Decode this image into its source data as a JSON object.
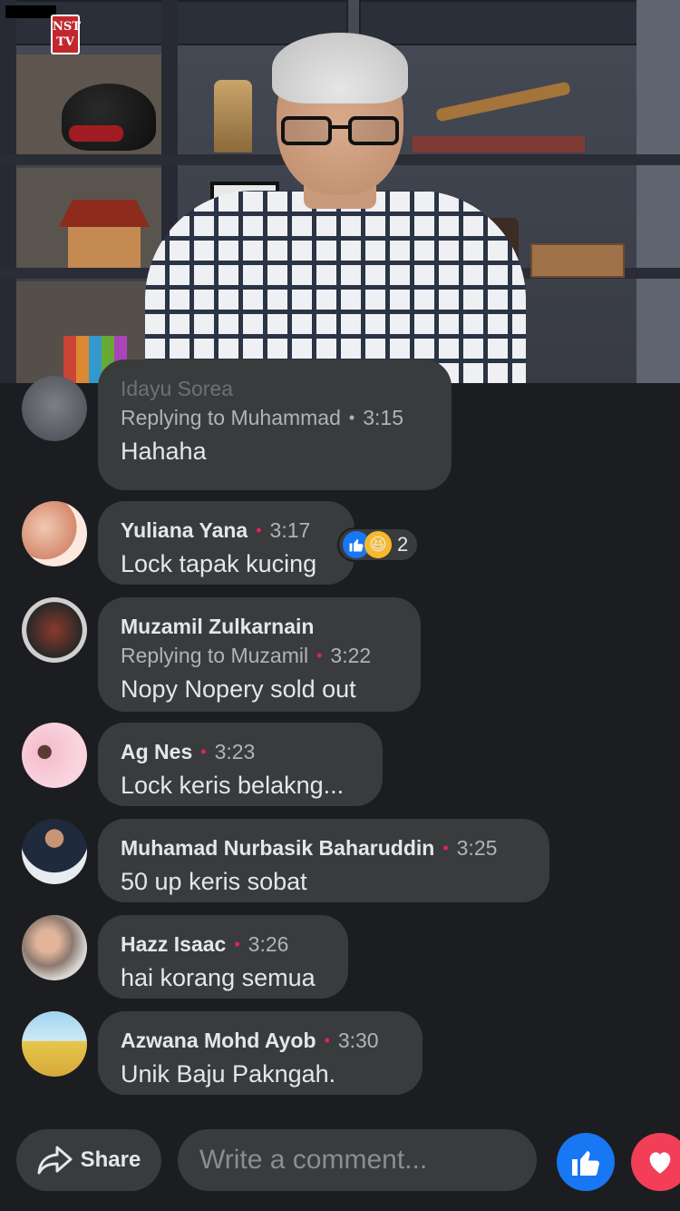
{
  "video": {
    "channel_logo_line1": "NST",
    "channel_logo_line2": "TV"
  },
  "comments": [
    {
      "author": "Idayu Sorea",
      "replying": "Replying to Muhammad",
      "time": "3:15",
      "text": "Hahaha"
    },
    {
      "author": "Yuliana Yana",
      "time": "3:17",
      "text": "Lock tapak kucing",
      "reactions": {
        "types": [
          "like-icon",
          "haha-icon"
        ],
        "count": "2"
      }
    },
    {
      "author": "Muzamil Zulkarnain",
      "replying": "Replying to Muzamil",
      "time": "3:22",
      "text": "Nopy Nopery sold out"
    },
    {
      "author": "Ag Nes",
      "time": "3:23",
      "text": "Lock keris belakng..."
    },
    {
      "author": "Muhamad Nurbasik Baharuddin",
      "time": "3:25",
      "text": "50 up keris sobat"
    },
    {
      "author": "Hazz Isaac",
      "time": "3:26",
      "text": "hai korang semua"
    },
    {
      "author": "Azwana Mohd Ayob",
      "time": "3:30",
      "text": "Unik Baju Pakngah."
    }
  ],
  "bottom_bar": {
    "share_label": "Share",
    "comment_placeholder": "Write a comment...",
    "like_icon": "like-icon",
    "love_icon": "love-icon"
  },
  "colors": {
    "background": "#1c1d20",
    "bubble": "#3a3b3c",
    "accent_blue": "#1877f2",
    "live_dot": "#e0245e",
    "love_red": "#f33e58"
  }
}
